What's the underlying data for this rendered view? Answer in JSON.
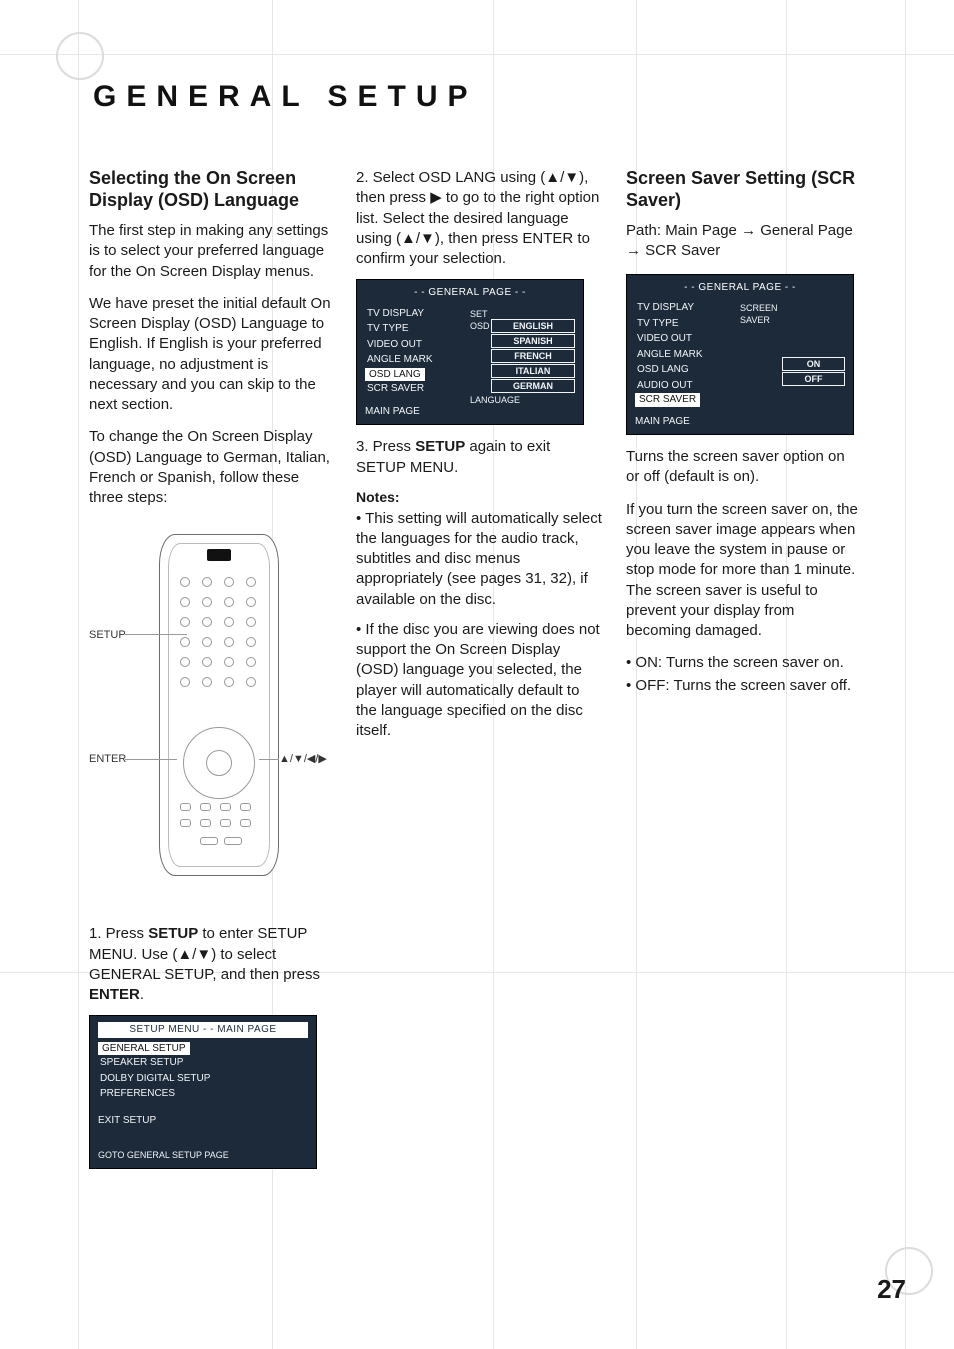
{
  "page_title": "GENERAL SETUP",
  "page_number": "27",
  "col1": {
    "heading": "Selecting the On Screen Display (OSD) Language",
    "p1": "The first step in making any settings is to select your preferred language for the On Screen Display menus.",
    "p2": "We have preset the initial default On Screen Display (OSD) Language to English. If English is your preferred language, no adjustment is necessary and you can skip to the next section.",
    "p3": "To change the On Screen Display (OSD) Language to German, Italian, French or Spanish, follow these three steps:",
    "remote_labels": {
      "setup": "SETUP",
      "enter": "ENTER",
      "arrows": "▲/▼/◀/▶"
    },
    "step1_prefix": "1. Press ",
    "step1_setup": "SETUP",
    "step1_mid": " to enter SETUP MENU. Use (▲/▼) to select GENERAL SETUP, and then press ",
    "step1_enter": "ENTER",
    "step1_suffix": ".",
    "osd1": {
      "title": "SETUP MENU - - MAIN PAGE",
      "items": [
        "GENERAL SETUP",
        "SPEAKER SETUP",
        "DOLBY DIGITAL SETUP",
        "PREFERENCES"
      ],
      "exit": "EXIT SETUP",
      "footer": "GOTO GENERAL SETUP PAGE"
    }
  },
  "col2": {
    "step2": "2. Select OSD LANG using (▲/▼), then press ▶ to go to the right option list. Select the desired language using (▲/▼), then press ENTER to confirm your selection.",
    "osd2": {
      "title": "- - GENERAL PAGE - -",
      "left": [
        "TV DISPLAY",
        "TV TYPE",
        "VIDEO OUT",
        "ANGLE MARK",
        "OSD LANG",
        "SCR SAVER"
      ],
      "right": [
        "ENGLISH",
        "SPANISH",
        "FRENCH",
        "ITALIAN",
        "GERMAN"
      ],
      "main": "MAIN PAGE",
      "footer": "SET OSD LANGUAGE"
    },
    "step3_prefix": "3. Press ",
    "step3_setup": "SETUP",
    "step3_suffix": " again to exit SETUP MENU.",
    "notes_label": "Notes:",
    "note1": "• This setting will automatically select the languages for the audio track, subtitles and disc menus appropriately (see pages 31, 32), if available on the disc.",
    "note2": "• If the disc you are viewing does not support the On Screen Display (OSD) language you selected, the player will automatically default to the language specified on the disc itself."
  },
  "col3": {
    "heading": "Screen Saver Setting (SCR Saver)",
    "path": "Path: Main Page → General Page → SCR Saver",
    "osd3": {
      "title": "- - GENERAL PAGE - -",
      "left": [
        "TV DISPLAY",
        "TV TYPE",
        "VIDEO OUT",
        "ANGLE MARK",
        "OSD LANG",
        "AUDIO OUT",
        "SCR SAVER"
      ],
      "right": [
        "ON",
        "OFF"
      ],
      "main": "MAIN PAGE",
      "footer": "SCREEN SAVER"
    },
    "p1": "Turns the screen saver option on or off (default is on).",
    "p2": "If you turn the screen saver on, the screen saver image appears when you leave the system in pause or stop mode for more than 1 minute. The screen saver is useful to prevent your display from becoming damaged.",
    "b1": "• ON: Turns the screen saver on.",
    "b2": "• OFF: Turns the screen saver off."
  }
}
